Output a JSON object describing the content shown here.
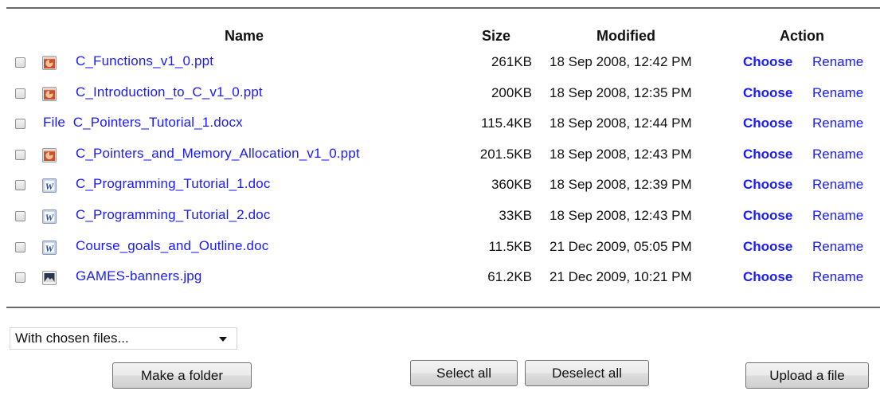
{
  "headers": {
    "name": "Name",
    "size": "Size",
    "modified": "Modified",
    "action": "Action"
  },
  "files": [
    {
      "icon": "powerpoint-icon",
      "name": "C_Functions_v1_0.ppt",
      "size": "261KB",
      "modified": "18 Sep 2008, 12:42 PM",
      "choose": "Choose",
      "rename": "Rename"
    },
    {
      "icon": "powerpoint-icon",
      "name": "C_Introduction_to_C_v1_0.ppt",
      "size": "200KB",
      "modified": "18 Sep 2008, 12:35 PM",
      "choose": "Choose",
      "rename": "Rename"
    },
    {
      "icon": "file-text",
      "icon_text": "File",
      "name": "C_Pointers_Tutorial_1.docx",
      "size": "115.4KB",
      "modified": "18 Sep 2008, 12:44 PM",
      "choose": "Choose",
      "rename": "Rename"
    },
    {
      "icon": "powerpoint-icon",
      "name": "C_Pointers_and_Memory_Allocation_v1_0.ppt",
      "size": "201.5KB",
      "modified": "18 Sep 2008, 12:43 PM",
      "choose": "Choose",
      "rename": "Rename"
    },
    {
      "icon": "word-icon",
      "name": "C_Programming_Tutorial_1.doc",
      "size": "360KB",
      "modified": "18 Sep 2008, 12:39 PM",
      "choose": "Choose",
      "rename": "Rename"
    },
    {
      "icon": "word-icon",
      "name": "C_Programming_Tutorial_2.doc",
      "size": "33KB",
      "modified": "18 Sep 2008, 12:43 PM",
      "choose": "Choose",
      "rename": "Rename"
    },
    {
      "icon": "word-icon",
      "name": "Course_goals_and_Outline.doc",
      "size": "11.5KB",
      "modified": "21 Dec 2009, 05:05 PM",
      "choose": "Choose",
      "rename": "Rename"
    },
    {
      "icon": "image-icon",
      "name": "GAMES-banners.jpg",
      "size": "61.2KB",
      "modified": "21 Dec 2009, 10:21 PM",
      "choose": "Choose",
      "rename": "Rename"
    }
  ],
  "bulk_action": {
    "selected": "With chosen files..."
  },
  "buttons": {
    "make_folder": "Make a folder",
    "select_all": "Select all",
    "deselect_all": "Deselect all",
    "upload": "Upload a file"
  },
  "colors": {
    "link": "#1a1aff",
    "rule": "#6a6a6a",
    "powerpoint": "#c8502a",
    "word": "#2c4fa8"
  }
}
